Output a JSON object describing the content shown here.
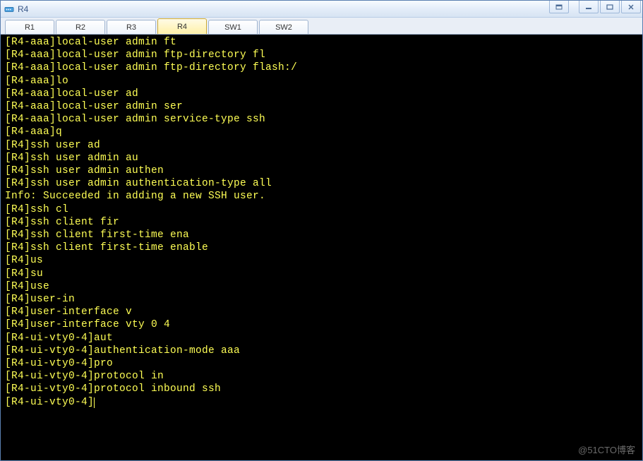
{
  "window": {
    "title": "R4"
  },
  "tabs": [
    {
      "label": "R1",
      "active": false
    },
    {
      "label": "R2",
      "active": false
    },
    {
      "label": "R3",
      "active": false
    },
    {
      "label": "R4",
      "active": true
    },
    {
      "label": "SW1",
      "active": false
    },
    {
      "label": "SW2",
      "active": false
    }
  ],
  "terminal": {
    "lines": [
      "[R4-aaa]local-user admin ft",
      "[R4-aaa]local-user admin ftp-directory fl",
      "[R4-aaa]local-user admin ftp-directory flash:/",
      "[R4-aaa]lo",
      "[R4-aaa]local-user ad",
      "[R4-aaa]local-user admin ser",
      "[R4-aaa]local-user admin service-type ssh",
      "[R4-aaa]q",
      "[R4]ssh user ad",
      "[R4]ssh user admin au",
      "[R4]ssh user admin authen",
      "[R4]ssh user admin authentication-type all",
      "Info: Succeeded in adding a new SSH user.",
      "[R4]ssh cl",
      "[R4]ssh client fir",
      "[R4]ssh client first-time ena",
      "[R4]ssh client first-time enable",
      "[R4]us",
      "[R4]su",
      "[R4]use",
      "[R4]user-in",
      "[R4]user-interface v",
      "[R4]user-interface vty 0 4",
      "[R4-ui-vty0-4]aut",
      "[R4-ui-vty0-4]authentication-mode aaa",
      "[R4-ui-vty0-4]pro",
      "[R4-ui-vty0-4]protocol in",
      "[R4-ui-vty0-4]protocol inbound ssh"
    ],
    "prompt_with_cursor": "[R4-ui-vty0-4]"
  },
  "watermark": "@51CTO博客"
}
